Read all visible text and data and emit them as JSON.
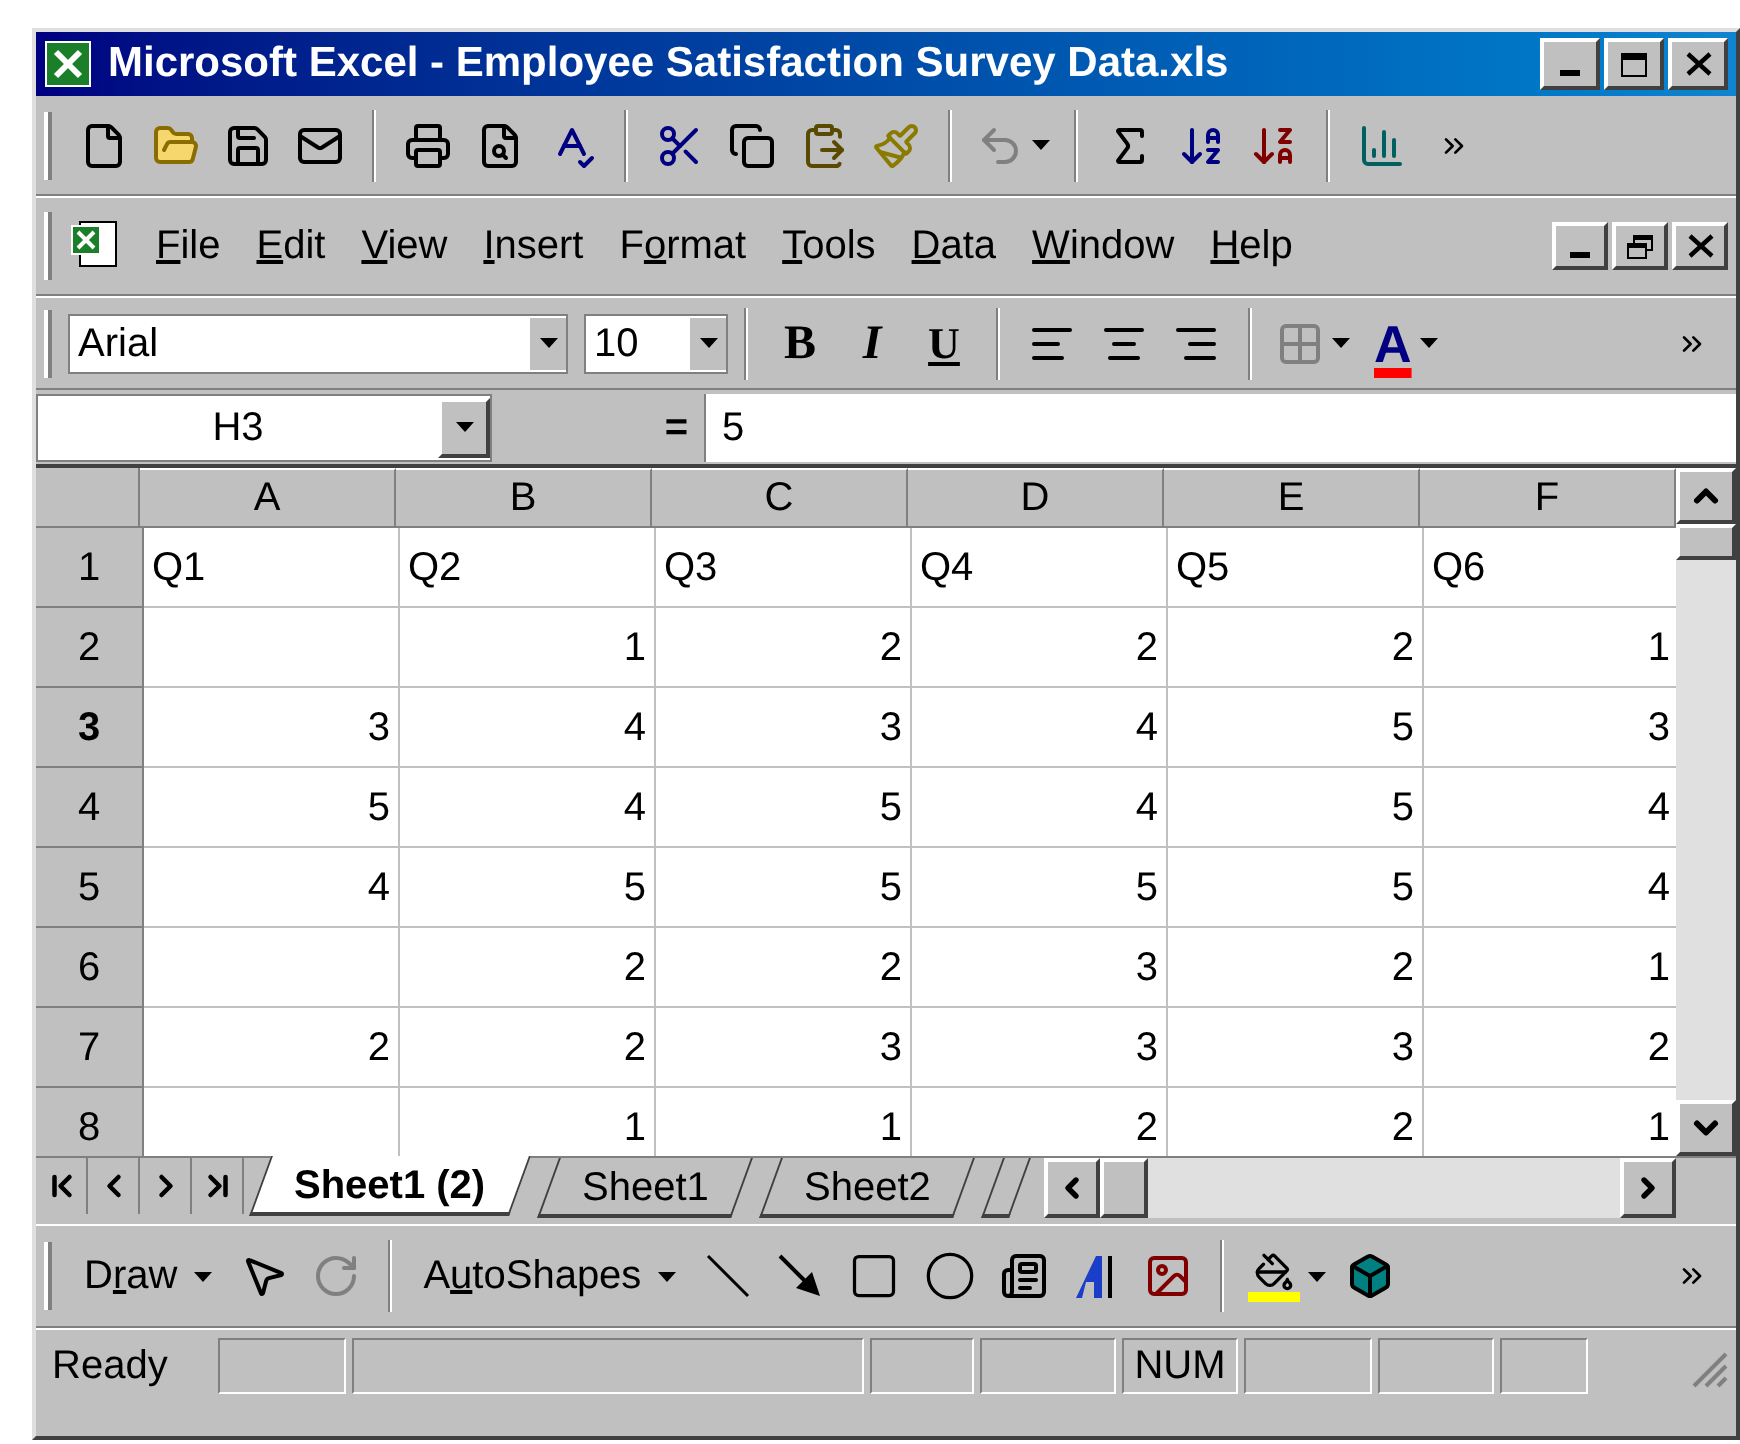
{
  "window": {
    "title": "Microsoft Excel - Employee Satisfaction Survey Data.xls"
  },
  "menu": [
    {
      "key": "F",
      "post": "ile"
    },
    {
      "key": "E",
      "post": "dit"
    },
    {
      "key": "V",
      "post": "iew"
    },
    {
      "key": "I",
      "post": "nsert"
    },
    {
      "pre": "F",
      "key": "o",
      "post": "rmat"
    },
    {
      "key": "T",
      "post": "ools"
    },
    {
      "key": "D",
      "post": "ata"
    },
    {
      "key": "W",
      "post": "indow"
    },
    {
      "key": "H",
      "post": "elp"
    }
  ],
  "formatting": {
    "font": "Arial",
    "size": "10",
    "bold": "B",
    "italic": "I",
    "underline": "U",
    "font_color": "A"
  },
  "formula_bar": {
    "name_box": "H3",
    "equals": "=",
    "value": "5"
  },
  "columns": [
    "A",
    "B",
    "C",
    "D",
    "E",
    "F"
  ],
  "rows": [
    {
      "header": "1",
      "selected": false,
      "kind": "text",
      "cells": [
        "Q1",
        "Q2",
        "Q3",
        "Q4",
        "Q5",
        "Q6"
      ]
    },
    {
      "header": "2",
      "selected": false,
      "kind": "number",
      "cells": [
        null,
        "1",
        "2",
        "2",
        "2",
        "1"
      ]
    },
    {
      "header": "3",
      "selected": true,
      "kind": "number",
      "cells": [
        "3",
        "4",
        "3",
        "4",
        "5",
        "3"
      ]
    },
    {
      "header": "4",
      "selected": false,
      "kind": "number",
      "cells": [
        "5",
        "4",
        "5",
        "4",
        "5",
        "4"
      ]
    },
    {
      "header": "5",
      "selected": false,
      "kind": "number",
      "cells": [
        "4",
        "5",
        "5",
        "5",
        "5",
        "4"
      ]
    },
    {
      "header": "6",
      "selected": false,
      "kind": "number",
      "cells": [
        null,
        "2",
        "2",
        "3",
        "2",
        "1"
      ]
    },
    {
      "header": "7",
      "selected": false,
      "kind": "number",
      "cells": [
        "2",
        "2",
        "3",
        "3",
        "3",
        "2"
      ]
    },
    {
      "header": "8",
      "selected": false,
      "kind": "number",
      "cells": [
        null,
        "1",
        "1",
        "2",
        "2",
        "1"
      ]
    }
  ],
  "sheet_tabs": [
    {
      "label": "Sheet1 (2)",
      "selected": true
    },
    {
      "label": "Sheet1",
      "selected": false
    },
    {
      "label": "Sheet2",
      "selected": false
    }
  ],
  "drawing_toolbar": [
    {
      "pre": "D",
      "key": "r",
      "post": "aw"
    },
    {
      "pre": "A",
      "key": "u",
      "post": "toShapes"
    }
  ],
  "status_bar": {
    "status": "Ready",
    "indicator": "NUM"
  }
}
